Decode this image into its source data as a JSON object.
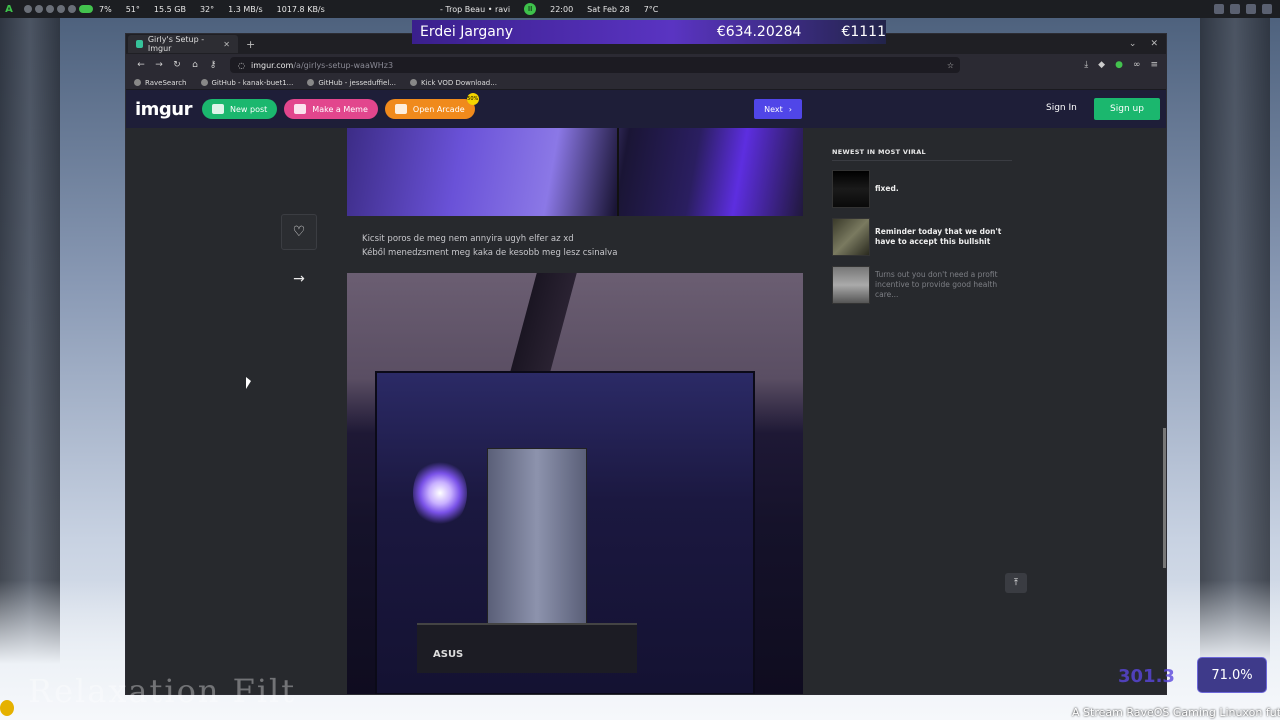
{
  "sysbar": {
    "cpu": "7%",
    "temp": "51°",
    "ram": "15.5 GB",
    "gpu_temp": "32°",
    "net_up": "1.3 MB/s",
    "net_down": "1017.8 KB/s",
    "track": "- Trop Beau • ravi",
    "time": "22:00",
    "date": "Sat Feb 28",
    "weather": "7°C"
  },
  "ticker": {
    "name": "Erdei Jargany",
    "value1": "€634.20284",
    "value2": "€1111"
  },
  "browser": {
    "tab_title": "Girly's Setup - Imgur",
    "url_host": "imgur.com",
    "url_path": "/a/girlys-setup-waaWHz3",
    "bookmarks": [
      "RaveSearch",
      "GitHub - kanak-buet1...",
      "GitHub - jesseduffiel...",
      "Kick VOD Download..."
    ]
  },
  "imgur": {
    "logo": "imgur",
    "new_post": "New post",
    "make_meme": "Make a Meme",
    "open_arcade": "Open Arcade",
    "arcade_badge": "50%",
    "next": "Next",
    "sign_in": "Sign In",
    "sign_up": "Sign up",
    "caption_line1": "Kicsit poros de meg nem annyira ugyh elfer az xd",
    "caption_line2": "Kéből menedzsment meg kaka de kesobb meg lesz csinalva",
    "gpu_brand": "ASUS",
    "sidebar_title": "NEWEST IN MOST VIRAL",
    "viral": [
      {
        "title": "fixed."
      },
      {
        "title": "Reminder today that we don't have to accept this bullshit"
      },
      {
        "title": "Turns out you don't need a profit incentive to provide good health care..."
      }
    ]
  },
  "overlay": {
    "watermark": "Relaxation Filt",
    "stat": "301.3",
    "percent": "71.0%",
    "stream_text": "A Stream RaveOS Gaming Linuxon fut"
  }
}
